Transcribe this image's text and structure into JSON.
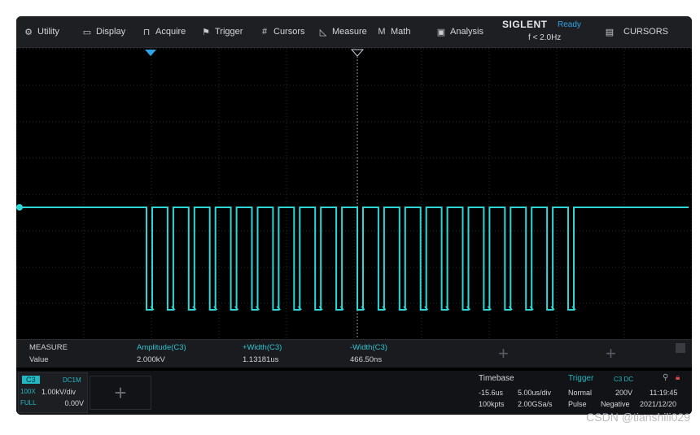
{
  "menu": {
    "items": [
      {
        "icon": "utility-icon",
        "glyph": "⚙",
        "label": "Utility"
      },
      {
        "icon": "display-icon",
        "glyph": "▭",
        "label": "Display"
      },
      {
        "icon": "acquire-icon",
        "glyph": "⊓",
        "label": "Acquire"
      },
      {
        "icon": "trigger-icon",
        "glyph": "⚑",
        "label": "Trigger"
      },
      {
        "icon": "cursors-icon",
        "glyph": "#",
        "label": "Cursors"
      },
      {
        "icon": "measure-icon",
        "glyph": "◺",
        "label": "Measure"
      },
      {
        "icon": "math-icon",
        "glyph": "M",
        "label": "Math"
      },
      {
        "icon": "analysis-icon",
        "glyph": "▣",
        "label": "Analysis"
      }
    ],
    "brand": "SIGLENT",
    "state": "Ready",
    "freq": "f < 2.0Hz",
    "right_icon": "document-icon",
    "right_label": "CURSORS"
  },
  "measure": {
    "header_label": "MEASURE",
    "value_label": "Value",
    "columns": [
      {
        "name": "Amplitude(C3)",
        "value": "2.000kV"
      },
      {
        "name": "+Width(C3)",
        "value": "1.13181us"
      },
      {
        "name": "-Width(C3)",
        "value": "466.50ns"
      }
    ]
  },
  "channel": {
    "label": "C3",
    "coupling": "DC1M",
    "probe": "100X",
    "scale": "1.00kV/div",
    "bw": "FULL",
    "offset": "0.00V"
  },
  "timebase": {
    "title": "Timebase",
    "delay": "-15.6us",
    "scale": "5.00us/div",
    "points": "100kpts",
    "rate": "2.00GSa/s"
  },
  "trigger": {
    "title": "Trigger",
    "source": "C3 DC",
    "mode": "Normal",
    "level": "200V",
    "type": "Pulse",
    "slope": "Negative"
  },
  "clock": {
    "time": "11:19:45",
    "date": "2021/12/20"
  },
  "waveform": {
    "color": "#2fd6d6",
    "pulse_count": 21
  },
  "colors": {
    "accent": "#21b8c3",
    "measure_header": "#2ec4cf",
    "state": "#2fa3e6"
  },
  "watermark": "CSDN @tianshili029"
}
